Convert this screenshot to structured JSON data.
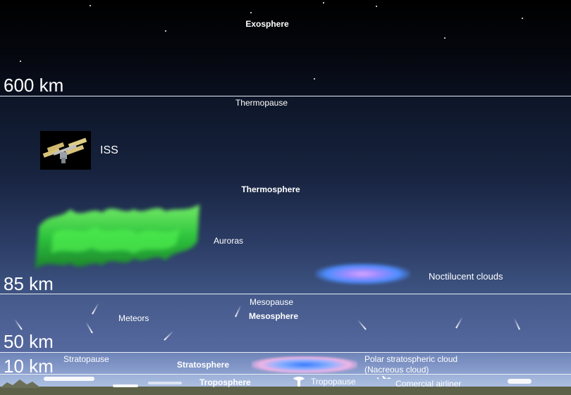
{
  "altitudes": {
    "km600": "600 km",
    "km85": "85 km",
    "km50": "50 km",
    "km10": "10 km"
  },
  "layers": {
    "exosphere": "Exosphere",
    "thermopause": "Thermopause",
    "thermosphere": "Thermosphere",
    "mesopause": "Mesopause",
    "mesosphere": "Mesosphere",
    "stratopause": "Stratopause",
    "stratosphere": "Stratosphere",
    "troposphere": "Troposphere",
    "tropopause": "Tropopause"
  },
  "objects": {
    "iss": "ISS",
    "auroras": "Auroras",
    "noctilucent": "Noctilucent clouds",
    "meteors": "Meteors",
    "polar_cloud_line1": "Polar stratospheric cloud",
    "polar_cloud_line2": "(Nacreous cloud)",
    "airliner": "Comercial airliner"
  },
  "colors": {
    "aurora": "#2fd43a",
    "noctilucent": "#4d8dff",
    "boundary": "#e8ecf4",
    "ground": "#5d6148"
  }
}
